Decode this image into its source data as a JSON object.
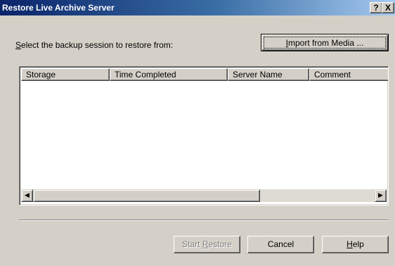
{
  "window": {
    "title": "Restore Live Archive Server",
    "help_glyph": "?",
    "close_glyph": "X"
  },
  "prompt": {
    "accel": "S",
    "rest": "elect the backup session to restore from:"
  },
  "import_button": {
    "accel": "I",
    "rest": "mport from Media ..."
  },
  "list": {
    "columns": [
      "Storage",
      "Time Completed",
      "Server Name",
      "Comment"
    ],
    "rows": []
  },
  "scrollbar": {
    "left_arrow_icon": "scroll-left-arrow",
    "right_arrow_icon": "scroll-right-arrow",
    "left_glyph": "◀",
    "right_glyph": "▶"
  },
  "buttons": {
    "start_restore": {
      "pre": "Start ",
      "accel": "R",
      "post": "estore",
      "enabled": false
    },
    "cancel": "Cancel",
    "help": {
      "accel": "H",
      "post": "elp"
    }
  },
  "colors": {
    "title_start": "#0a246a",
    "title_end": "#a6caf0",
    "face": "#d4d0c8"
  }
}
